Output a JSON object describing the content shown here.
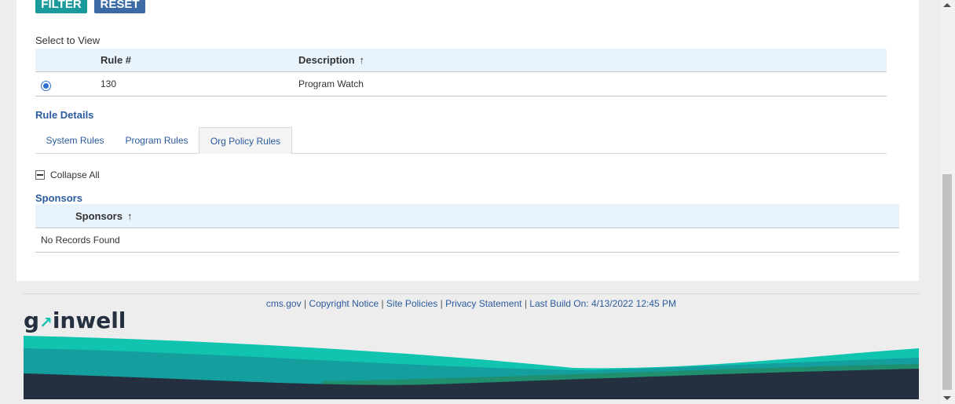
{
  "toolbar": {
    "filter_label": "FILTER",
    "reset_label": "RESET"
  },
  "select_to_view": {
    "label": "Select to View",
    "columns": [
      "Rule #",
      "Description"
    ],
    "sort_indicator": "↑",
    "rows": [
      {
        "selected": true,
        "rule_number": "130",
        "description": "Program Watch"
      }
    ]
  },
  "rule_details": {
    "title": "Rule Details",
    "tabs": [
      {
        "label": "System Rules",
        "active": false
      },
      {
        "label": "Program Rules",
        "active": false
      },
      {
        "label": "Org Policy Rules",
        "active": true
      }
    ],
    "collapse_all_label": "Collapse All"
  },
  "sponsors": {
    "title": "Sponsors",
    "column": "Sponsors",
    "sort_indicator": "↑",
    "empty_text": "No Records Found"
  },
  "footer": {
    "links": [
      "cms.gov",
      "Copyright Notice",
      "Site Policies",
      "Privacy Statement"
    ],
    "separator": "|",
    "last_build": "Last Build On: 4/13/2022 12:45 PM",
    "logo_text_pre": "g",
    "logo_text_post": "inwell",
    "logo_arrow": "↗"
  },
  "colors": {
    "accent_teal": "#1a9a9a",
    "accent_blue": "#3b6aa5",
    "header_bg": "#e8f3fc",
    "link_blue": "#2a5b9e",
    "wave_dark": "#24303f",
    "wave_teal": "#10c4b0",
    "wave_green": "#1f8f6e"
  }
}
